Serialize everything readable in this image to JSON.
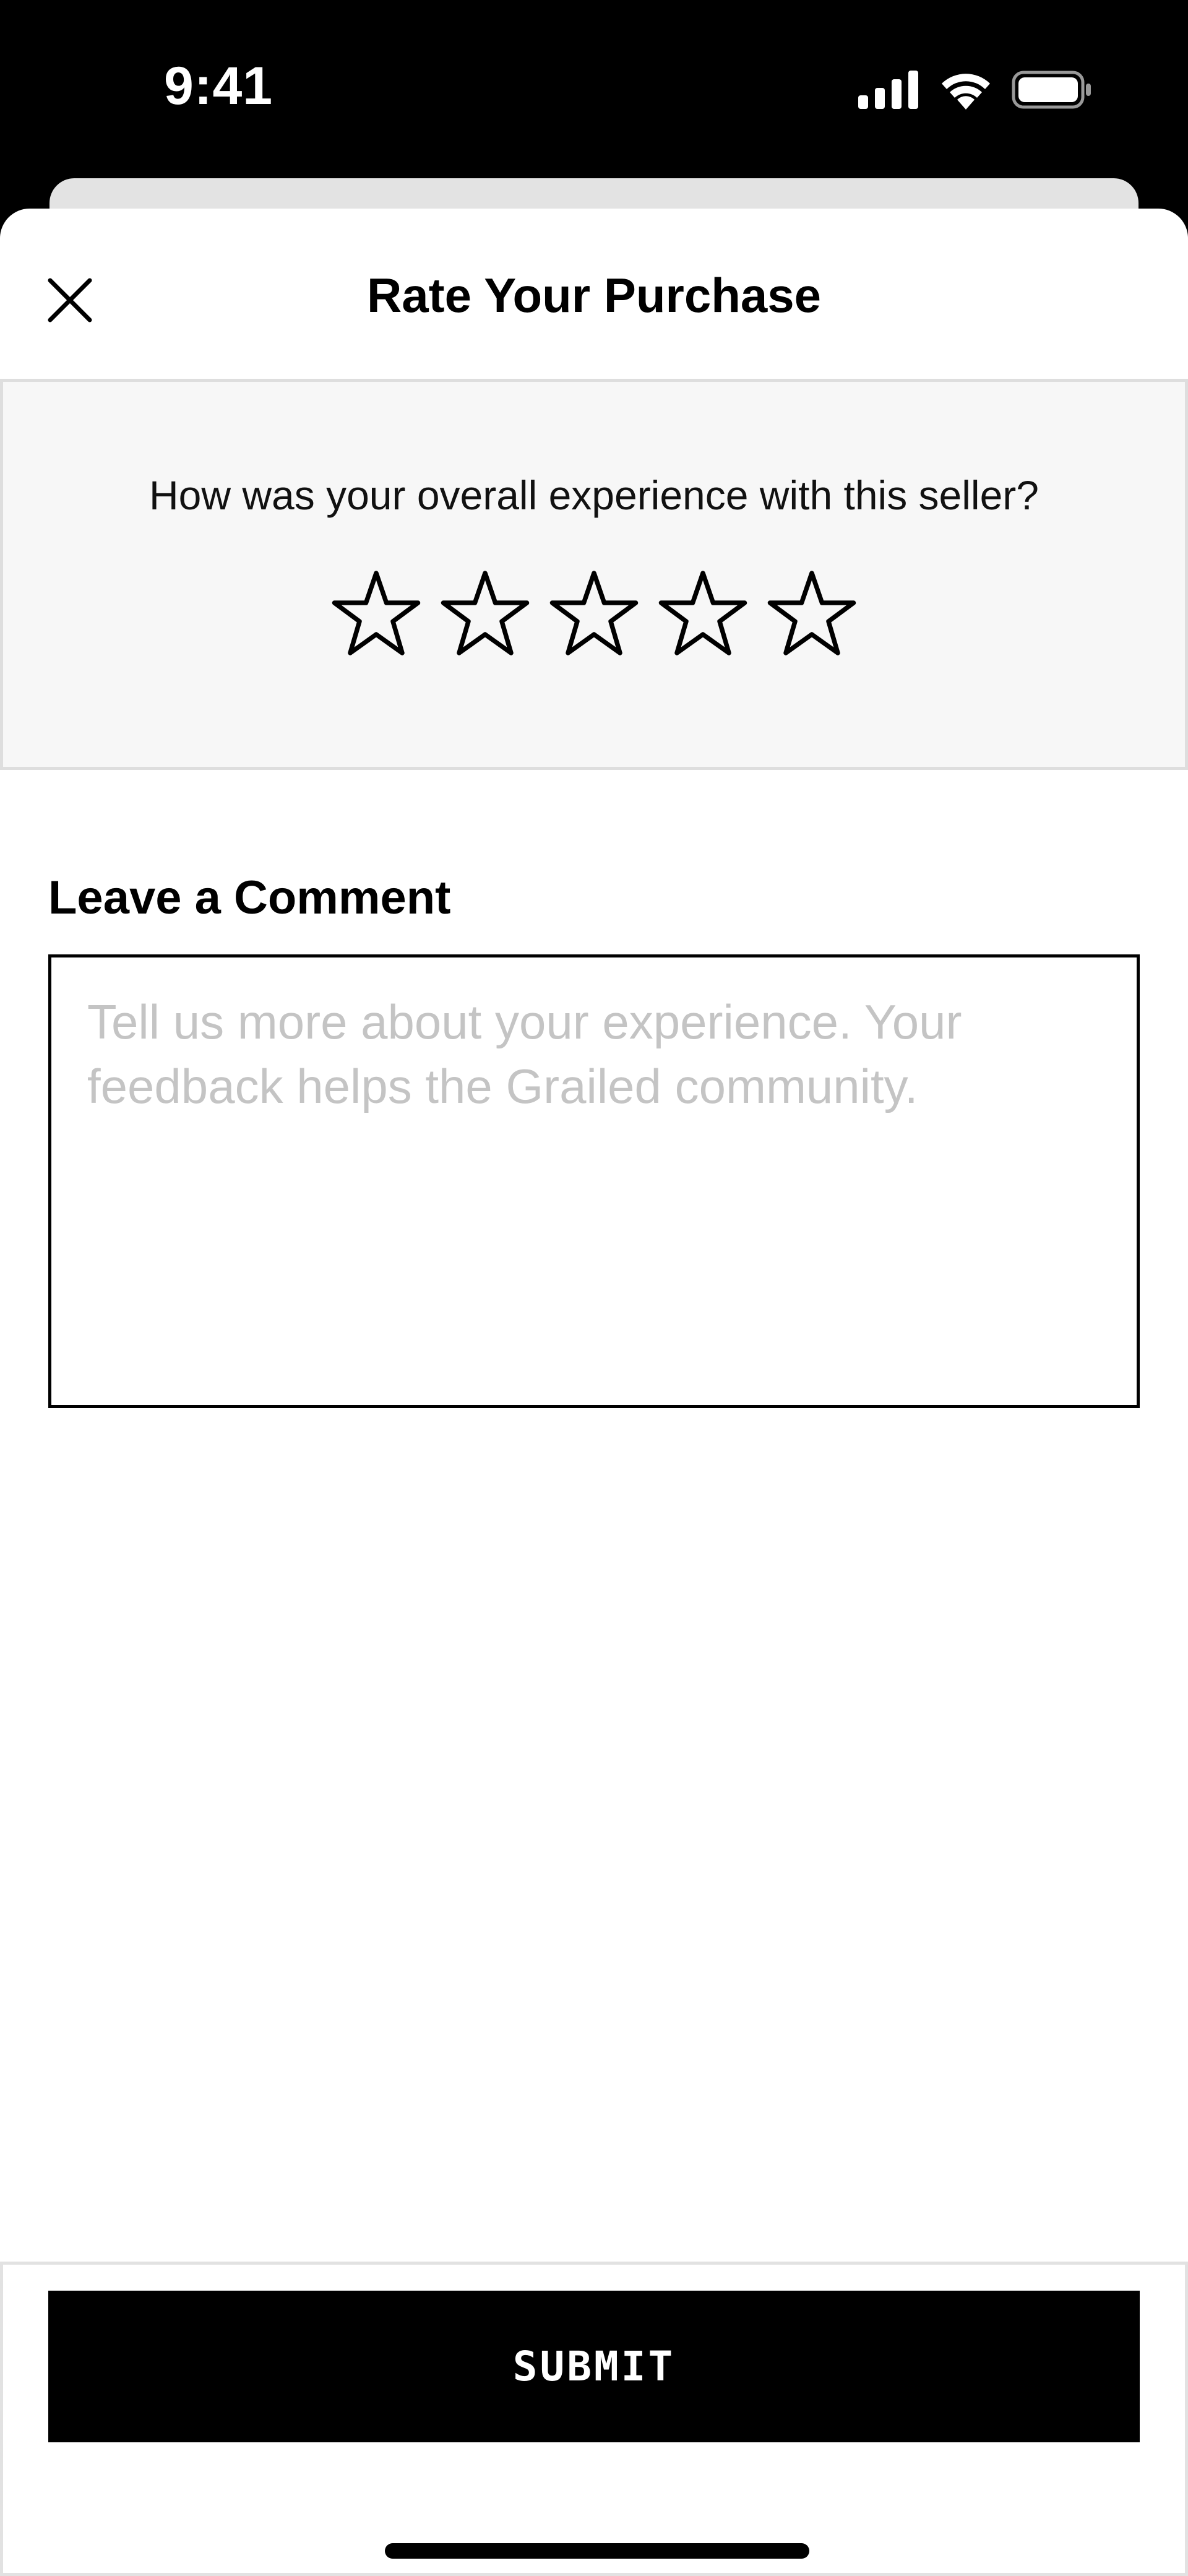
{
  "status_bar": {
    "time": "9:41",
    "icons": [
      "cellular-signal-icon",
      "wifi-icon",
      "battery-icon"
    ]
  },
  "header": {
    "title": "Rate Your Purchase",
    "close_icon": "close-icon"
  },
  "rating": {
    "question": "How was your overall experience with this seller?",
    "max_stars": 5,
    "selected_stars": 0,
    "star_icon": "star-outline-icon"
  },
  "comment": {
    "label": "Leave a Comment",
    "value": "",
    "placeholder": "Tell us more about your experience. Your feedback helps the Grailed community."
  },
  "footer": {
    "submit_label": "SUBMIT"
  },
  "colors": {
    "primary": "#000000",
    "panel_background": "#f7f7f7",
    "placeholder": "#c4c4c4"
  }
}
